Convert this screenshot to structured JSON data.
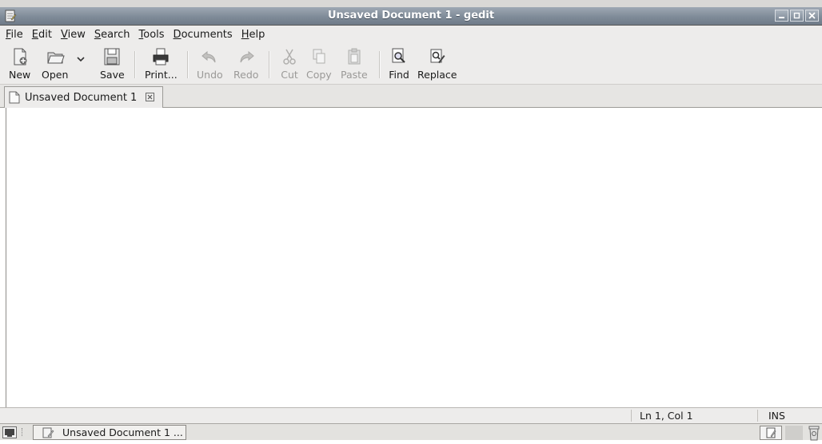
{
  "window": {
    "title": "Unsaved Document 1 - gedit"
  },
  "menubar": {
    "items": [
      {
        "pre": "",
        "mn": "F",
        "post": "ile"
      },
      {
        "pre": "",
        "mn": "E",
        "post": "dit"
      },
      {
        "pre": "",
        "mn": "V",
        "post": "iew"
      },
      {
        "pre": "",
        "mn": "S",
        "post": "earch"
      },
      {
        "pre": "",
        "mn": "T",
        "post": "ools"
      },
      {
        "pre": "",
        "mn": "D",
        "post": "ocuments"
      },
      {
        "pre": "",
        "mn": "H",
        "post": "elp"
      }
    ]
  },
  "toolbar": {
    "new": "New",
    "open": "Open",
    "save": "Save",
    "print": "Print...",
    "undo": "Undo",
    "redo": "Redo",
    "cut": "Cut",
    "copy": "Copy",
    "paste": "Paste",
    "find": "Find",
    "replace": "Replace"
  },
  "tabs": [
    {
      "label": "Unsaved Document 1"
    }
  ],
  "statusbar": {
    "position": "Ln 1, Col 1",
    "mode": "INS"
  },
  "taskbar": {
    "task_label": "Unsaved Document 1 ..."
  },
  "colors": {
    "titlebar": "#7f8b98",
    "chrome": "#edeceb",
    "editor_bg": "#ffffff"
  }
}
